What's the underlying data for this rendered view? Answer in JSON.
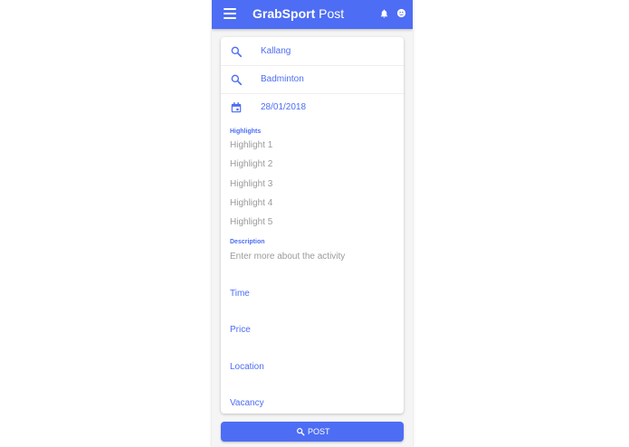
{
  "app": {
    "title_bold": "GrabSport",
    "title_rest": " Post"
  },
  "appbar_icons": [
    "menu-icon",
    "notifications-bell-icon",
    "account-face-icon"
  ],
  "form": {
    "location_value": "Kallang",
    "sport_value": "Badminton",
    "date_value": "28/01/2018",
    "highlights_label": "Highlights",
    "highlights": [
      "Highlight 1",
      "Highlight 2",
      "Highlight 3",
      "Highlight 4",
      "Highlight 5"
    ],
    "description_label": "Description",
    "description_placeholder": "Enter more about the activity",
    "extra_fields": [
      "Time",
      "Price",
      "Location",
      "Vacancy"
    ]
  },
  "post_button": {
    "label": "POST"
  },
  "colors": {
    "primary": "#4d6df4",
    "placeholder": "#9a9a9a"
  }
}
